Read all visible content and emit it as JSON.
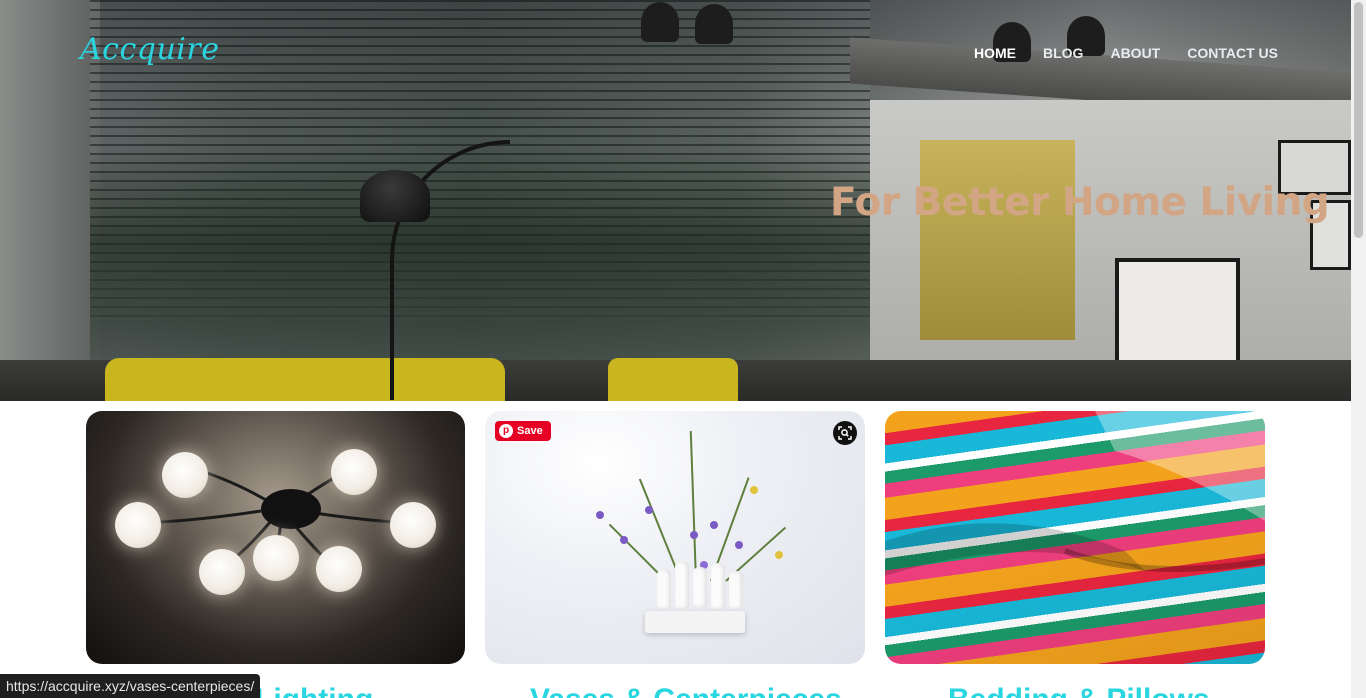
{
  "site": {
    "logo": "Accquire",
    "tagline": "For Better Home Living"
  },
  "nav": {
    "items": [
      {
        "label": "HOME",
        "active": true
      },
      {
        "label": "BLOG",
        "active": false
      },
      {
        "label": "ABOUT",
        "active": false
      },
      {
        "label": "CONTACT US",
        "active": false
      }
    ]
  },
  "cards": [
    {
      "title": "Lighting",
      "image": "chandelier-image"
    },
    {
      "title": "Vases & Centerpieces",
      "image": "vases-image",
      "save_label": "Save"
    },
    {
      "title": "Bedding & Pillows",
      "image": "pillows-image"
    }
  ],
  "status_bar": {
    "url": "https://accquire.xyz/vases-centerpieces/"
  },
  "colors": {
    "brand_cyan": "#29d6e0",
    "tagline": "#d2a585",
    "pinterest_red": "#e60023"
  }
}
